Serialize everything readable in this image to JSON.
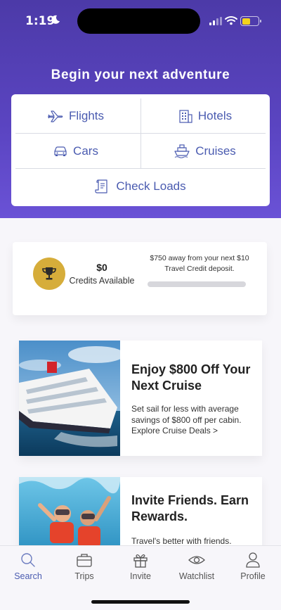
{
  "status_bar": {
    "time": "1:19",
    "battery_level": 0.5,
    "colors": {
      "battery": "#f2d21c"
    }
  },
  "hero": {
    "title": "Begin your next adventure",
    "background": "#5b45c2"
  },
  "search_options": {
    "flights": {
      "label": "Flights",
      "icon": "plane-icon"
    },
    "hotels": {
      "label": "Hotels",
      "icon": "building-icon"
    },
    "cars": {
      "label": "Cars",
      "icon": "car-icon"
    },
    "cruises": {
      "label": "Cruises",
      "icon": "ship-icon"
    },
    "check_loads": {
      "label": "Check Loads",
      "icon": "document-icon"
    },
    "accent_color": "#4a5bb0"
  },
  "credits": {
    "amount": "$0",
    "label": "Credits Available",
    "note": "$750 away from your next $10 Travel Credit deposit.",
    "progress": 0,
    "icon": "trophy-icon",
    "badge_color": "#d6ad3a"
  },
  "promos": [
    {
      "title": "Enjoy $800 Off Your Next Cruise",
      "body": "Set sail for less with average savings of $800 off per cabin.",
      "link": "Explore Cruise Deals >",
      "image": "cruise-ship-image"
    },
    {
      "title": "Invite Friends. Earn Rewards.",
      "body": "Travel's better with friends.",
      "image": "snorkeling-image"
    }
  ],
  "tab_bar": {
    "tabs": [
      {
        "label": "Search",
        "icon": "search-icon",
        "active": true
      },
      {
        "label": "Trips",
        "icon": "briefcase-icon",
        "active": false
      },
      {
        "label": "Invite",
        "icon": "gift-icon",
        "active": false
      },
      {
        "label": "Watchlist",
        "icon": "eye-icon",
        "active": false
      },
      {
        "label": "Profile",
        "icon": "person-icon",
        "active": false
      }
    ],
    "active_color": "#4a5bb0"
  }
}
